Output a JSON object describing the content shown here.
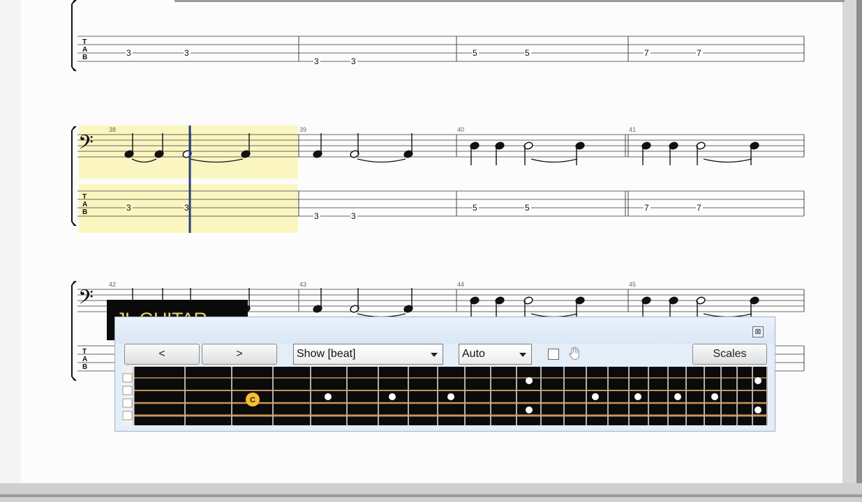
{
  "score": {
    "systems": [
      {
        "measures": [
          {
            "number": "",
            "tab": [
              {
                "fret": "3",
                "string": 3
              },
              {
                "fret": "3",
                "string": 3
              }
            ]
          },
          {
            "number": "",
            "tab": [
              {
                "fret": "3",
                "string": 4
              },
              {
                "fret": "3",
                "string": 4
              }
            ]
          },
          {
            "number": "",
            "tab": [
              {
                "fret": "5",
                "string": 3
              },
              {
                "fret": "5",
                "string": 3
              }
            ]
          },
          {
            "number": "",
            "tab": [
              {
                "fret": "7",
                "string": 3
              },
              {
                "fret": "7",
                "string": 3
              }
            ]
          }
        ]
      },
      {
        "measures": [
          {
            "number": "38",
            "tab": [
              {
                "fret": "3",
                "string": 3
              },
              {
                "fret": "3",
                "string": 3
              }
            ]
          },
          {
            "number": "39",
            "tab": [
              {
                "fret": "3",
                "string": 4
              },
              {
                "fret": "3",
                "string": 4
              }
            ]
          },
          {
            "number": "40",
            "tab": [
              {
                "fret": "5",
                "string": 3
              },
              {
                "fret": "5",
                "string": 3
              }
            ]
          },
          {
            "number": "41",
            "tab": [
              {
                "fret": "7",
                "string": 3
              },
              {
                "fret": "7",
                "string": 3
              }
            ]
          }
        ]
      },
      {
        "measures": [
          {
            "number": "42"
          },
          {
            "number": "43"
          },
          {
            "number": "44"
          },
          {
            "number": "45"
          }
        ]
      }
    ],
    "tab_label": [
      "T",
      "A",
      "B"
    ],
    "clef_glyph": "𝄢",
    "highlight_color": "#fbf6bf",
    "cursor_color": "#2a3a7a"
  },
  "watermark": {
    "text": "JL GUITAR"
  },
  "fretboard_window": {
    "close_glyph": "⊠",
    "prev_button": "<",
    "next_button": ">",
    "show_select": "Show [beat]",
    "auto_select": "Auto",
    "scales_button": "Scales",
    "highlighted_note": "C",
    "note_color": "#f2c12e",
    "string_color": "#c8955a",
    "board_color": "#0b0b0b"
  }
}
